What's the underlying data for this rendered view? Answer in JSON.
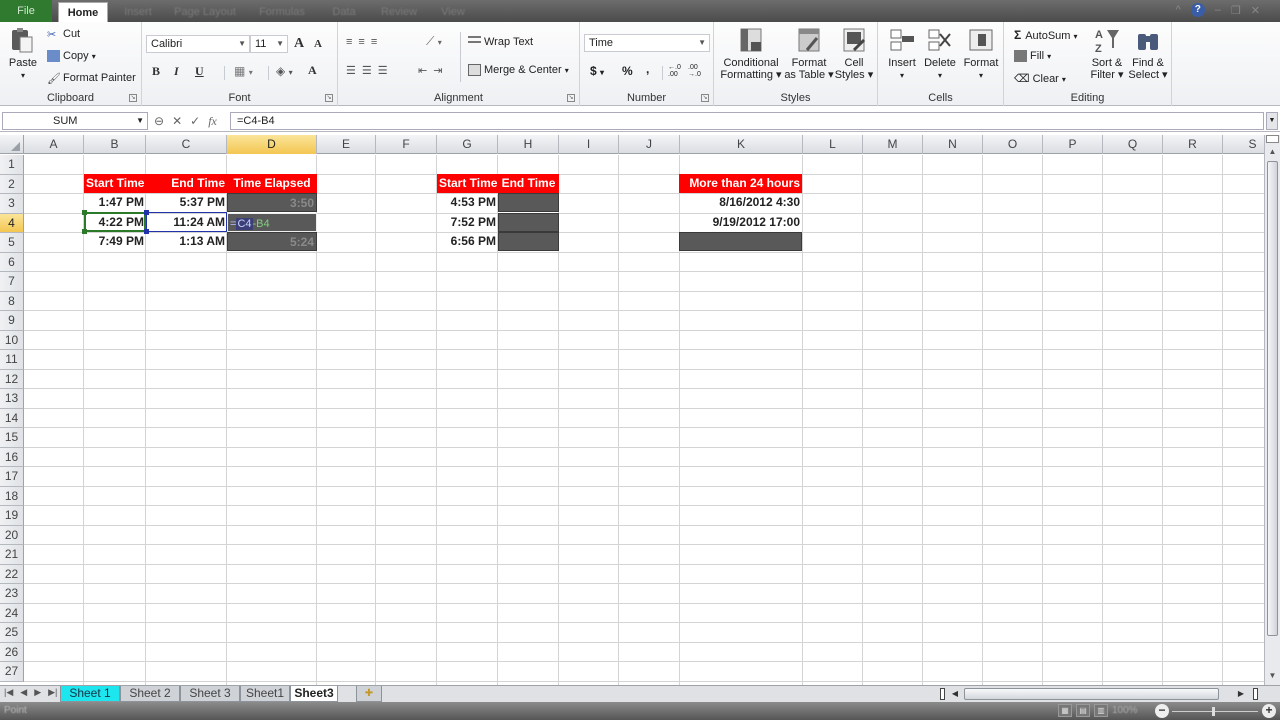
{
  "ribbon_tabs": {
    "file": "File",
    "home": "Home",
    "insert": "Insert",
    "page_layout": "Page Layout",
    "formulas": "Formulas",
    "data": "Data",
    "review": "Review",
    "view": "View"
  },
  "clipboard": {
    "paste": "Paste",
    "cut": "Cut",
    "copy": "Copy",
    "format_painter": "Format Painter",
    "label": "Clipboard"
  },
  "font": {
    "name": "Calibri",
    "size": "11",
    "grow": "A",
    "shrink": "A",
    "bold": "B",
    "italic": "I",
    "underline": "U",
    "font_color": "A",
    "label": "Font"
  },
  "alignment": {
    "wrap_text": "Wrap Text",
    "merge_center": "Merge & Center",
    "label": "Alignment"
  },
  "number": {
    "format": "Time",
    "currency": "$",
    "percent": "%",
    "comma": ",",
    "inc_decimal": "←.0 .00",
    "dec_decimal": ".00 →.0",
    "label": "Number"
  },
  "styles": {
    "conditional_formatting": [
      "Conditional",
      "Formatting ▾"
    ],
    "format_as_table": [
      "Format",
      "as Table ▾"
    ],
    "cell_styles": [
      "Cell",
      "Styles ▾"
    ],
    "label": "Styles"
  },
  "cells": {
    "insert": "Insert",
    "delete": "Delete",
    "format": "Format",
    "label": "Cells"
  },
  "editing": {
    "autosum": "AutoSum",
    "fill": "Fill",
    "clear": "Clear",
    "sort_filter": [
      "Sort &",
      "Filter ▾"
    ],
    "find_select": [
      "Find &",
      "Select ▾"
    ],
    "label": "Editing"
  },
  "formula_bar": {
    "name_box": "SUM",
    "formula": "=C4-B4"
  },
  "grid": {
    "columns": [
      "A",
      "B",
      "C",
      "D",
      "E",
      "F",
      "G",
      "H",
      "I",
      "J",
      "K",
      "L",
      "M",
      "N",
      "O",
      "P",
      "Q",
      "R",
      "S"
    ],
    "active_column": "D",
    "rows": [
      "1",
      "2",
      "3",
      "4",
      "5",
      "6",
      "7",
      "8",
      "9",
      "10",
      "11",
      "12",
      "13",
      "14",
      "15",
      "16",
      "17",
      "18",
      "19",
      "20",
      "21",
      "22",
      "23",
      "24",
      "25",
      "26",
      "27"
    ],
    "active_row": "4",
    "table1": {
      "headers": [
        "Start Time",
        "End Time",
        "Time Elapsed"
      ],
      "rows": [
        [
          "1:47 PM",
          "5:37 PM",
          "3:50"
        ],
        [
          "4:22 PM",
          "11:24 AM",
          "=C4-B4"
        ],
        [
          "7:49 PM",
          "1:13 AM",
          "5:24"
        ]
      ]
    },
    "table2": {
      "headers": [
        "Start Time",
        "End Time"
      ],
      "rows": [
        [
          "4:53 PM",
          ""
        ],
        [
          "7:52 PM",
          ""
        ],
        [
          "6:56 PM",
          ""
        ]
      ]
    },
    "table3": {
      "header": "More than 24 hours",
      "rows": [
        "8/16/2012 4:30",
        "9/19/2012 17:00",
        ""
      ]
    },
    "edit_formula_prefix": "=",
    "edit_formula_ref": "C4",
    "edit_formula_suffix": "-B4"
  },
  "sheets": [
    {
      "name": "Sheet 1",
      "state": "colored"
    },
    {
      "name": "Sheet 2",
      "state": "normal"
    },
    {
      "name": "Sheet 3",
      "state": "normal"
    },
    {
      "name": "Sheet1",
      "state": "normal"
    },
    {
      "name": "Sheet3",
      "state": "active"
    }
  ],
  "status": {
    "mode": "Point",
    "zoom": "100%"
  }
}
